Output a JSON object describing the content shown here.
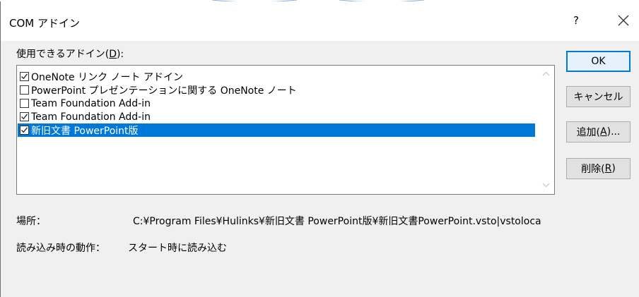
{
  "dialog": {
    "title": "COM アドイン",
    "help_symbol": "?",
    "close_icon": "close-icon"
  },
  "list": {
    "label_prefix": "使用できるアドイン(",
    "label_hotkey": "D",
    "label_suffix": "):",
    "items": [
      {
        "label": "OneNote リンク ノート アドイン",
        "checked": true,
        "selected": false
      },
      {
        "label": "PowerPoint プレゼンテーションに関する OneNote ノート",
        "checked": false,
        "selected": false
      },
      {
        "label": "Team Foundation Add-in",
        "checked": false,
        "selected": false
      },
      {
        "label": "Team Foundation Add-in",
        "checked": true,
        "selected": false
      },
      {
        "label": "新旧文書 PowerPoint版",
        "checked": true,
        "selected": true
      }
    ]
  },
  "buttons": {
    "ok": "OK",
    "cancel": "キャンセル",
    "add_prefix": "追加(",
    "add_hotkey": "A",
    "add_suffix": ")...",
    "remove_prefix": "削除(",
    "remove_hotkey": "R",
    "remove_suffix": ")"
  },
  "info": {
    "location_label": "場所：",
    "location_value": "C:¥Program Files¥Hulinks¥新旧文書 PowerPoint版¥新旧文書PowerPoint.vsto|vstoloca",
    "load_label": "読み込み時の動作：",
    "load_value": "スタート時に読み込む"
  },
  "colors": {
    "selection": "#0078d7",
    "default_button_border": "#0078d7",
    "dialog_bg": "#f0f0f0"
  }
}
